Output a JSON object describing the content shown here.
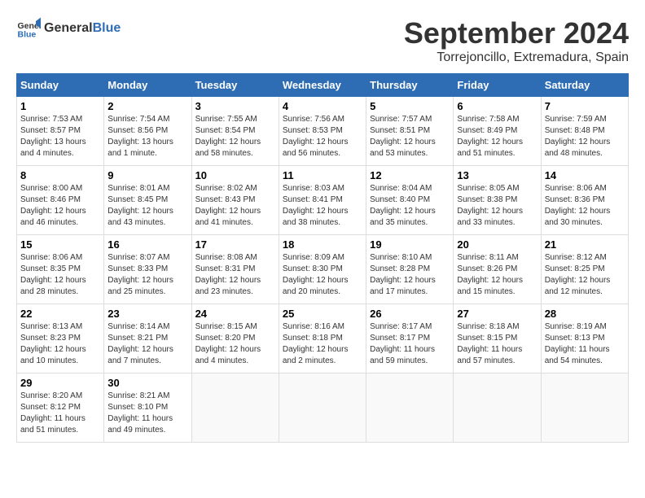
{
  "header": {
    "logo_general": "General",
    "logo_blue": "Blue",
    "month_title": "September 2024",
    "location": "Torrejoncillo, Extremadura, Spain"
  },
  "calendar": {
    "weekdays": [
      "Sunday",
      "Monday",
      "Tuesday",
      "Wednesday",
      "Thursday",
      "Friday",
      "Saturday"
    ],
    "weeks": [
      [
        {
          "day": "1",
          "info": "Sunrise: 7:53 AM\nSunset: 8:57 PM\nDaylight: 13 hours\nand 4 minutes."
        },
        {
          "day": "2",
          "info": "Sunrise: 7:54 AM\nSunset: 8:56 PM\nDaylight: 13 hours\nand 1 minute."
        },
        {
          "day": "3",
          "info": "Sunrise: 7:55 AM\nSunset: 8:54 PM\nDaylight: 12 hours\nand 58 minutes."
        },
        {
          "day": "4",
          "info": "Sunrise: 7:56 AM\nSunset: 8:53 PM\nDaylight: 12 hours\nand 56 minutes."
        },
        {
          "day": "5",
          "info": "Sunrise: 7:57 AM\nSunset: 8:51 PM\nDaylight: 12 hours\nand 53 minutes."
        },
        {
          "day": "6",
          "info": "Sunrise: 7:58 AM\nSunset: 8:49 PM\nDaylight: 12 hours\nand 51 minutes."
        },
        {
          "day": "7",
          "info": "Sunrise: 7:59 AM\nSunset: 8:48 PM\nDaylight: 12 hours\nand 48 minutes."
        }
      ],
      [
        {
          "day": "8",
          "info": "Sunrise: 8:00 AM\nSunset: 8:46 PM\nDaylight: 12 hours\nand 46 minutes."
        },
        {
          "day": "9",
          "info": "Sunrise: 8:01 AM\nSunset: 8:45 PM\nDaylight: 12 hours\nand 43 minutes."
        },
        {
          "day": "10",
          "info": "Sunrise: 8:02 AM\nSunset: 8:43 PM\nDaylight: 12 hours\nand 41 minutes."
        },
        {
          "day": "11",
          "info": "Sunrise: 8:03 AM\nSunset: 8:41 PM\nDaylight: 12 hours\nand 38 minutes."
        },
        {
          "day": "12",
          "info": "Sunrise: 8:04 AM\nSunset: 8:40 PM\nDaylight: 12 hours\nand 35 minutes."
        },
        {
          "day": "13",
          "info": "Sunrise: 8:05 AM\nSunset: 8:38 PM\nDaylight: 12 hours\nand 33 minutes."
        },
        {
          "day": "14",
          "info": "Sunrise: 8:06 AM\nSunset: 8:36 PM\nDaylight: 12 hours\nand 30 minutes."
        }
      ],
      [
        {
          "day": "15",
          "info": "Sunrise: 8:06 AM\nSunset: 8:35 PM\nDaylight: 12 hours\nand 28 minutes."
        },
        {
          "day": "16",
          "info": "Sunrise: 8:07 AM\nSunset: 8:33 PM\nDaylight: 12 hours\nand 25 minutes."
        },
        {
          "day": "17",
          "info": "Sunrise: 8:08 AM\nSunset: 8:31 PM\nDaylight: 12 hours\nand 23 minutes."
        },
        {
          "day": "18",
          "info": "Sunrise: 8:09 AM\nSunset: 8:30 PM\nDaylight: 12 hours\nand 20 minutes."
        },
        {
          "day": "19",
          "info": "Sunrise: 8:10 AM\nSunset: 8:28 PM\nDaylight: 12 hours\nand 17 minutes."
        },
        {
          "day": "20",
          "info": "Sunrise: 8:11 AM\nSunset: 8:26 PM\nDaylight: 12 hours\nand 15 minutes."
        },
        {
          "day": "21",
          "info": "Sunrise: 8:12 AM\nSunset: 8:25 PM\nDaylight: 12 hours\nand 12 minutes."
        }
      ],
      [
        {
          "day": "22",
          "info": "Sunrise: 8:13 AM\nSunset: 8:23 PM\nDaylight: 12 hours\nand 10 minutes."
        },
        {
          "day": "23",
          "info": "Sunrise: 8:14 AM\nSunset: 8:21 PM\nDaylight: 12 hours\nand 7 minutes."
        },
        {
          "day": "24",
          "info": "Sunrise: 8:15 AM\nSunset: 8:20 PM\nDaylight: 12 hours\nand 4 minutes."
        },
        {
          "day": "25",
          "info": "Sunrise: 8:16 AM\nSunset: 8:18 PM\nDaylight: 12 hours\nand 2 minutes."
        },
        {
          "day": "26",
          "info": "Sunrise: 8:17 AM\nSunset: 8:17 PM\nDaylight: 11 hours\nand 59 minutes."
        },
        {
          "day": "27",
          "info": "Sunrise: 8:18 AM\nSunset: 8:15 PM\nDaylight: 11 hours\nand 57 minutes."
        },
        {
          "day": "28",
          "info": "Sunrise: 8:19 AM\nSunset: 8:13 PM\nDaylight: 11 hours\nand 54 minutes."
        }
      ],
      [
        {
          "day": "29",
          "info": "Sunrise: 8:20 AM\nSunset: 8:12 PM\nDaylight: 11 hours\nand 51 minutes."
        },
        {
          "day": "30",
          "info": "Sunrise: 8:21 AM\nSunset: 8:10 PM\nDaylight: 11 hours\nand 49 minutes."
        },
        {
          "day": "",
          "info": ""
        },
        {
          "day": "",
          "info": ""
        },
        {
          "day": "",
          "info": ""
        },
        {
          "day": "",
          "info": ""
        },
        {
          "day": "",
          "info": ""
        }
      ]
    ]
  }
}
